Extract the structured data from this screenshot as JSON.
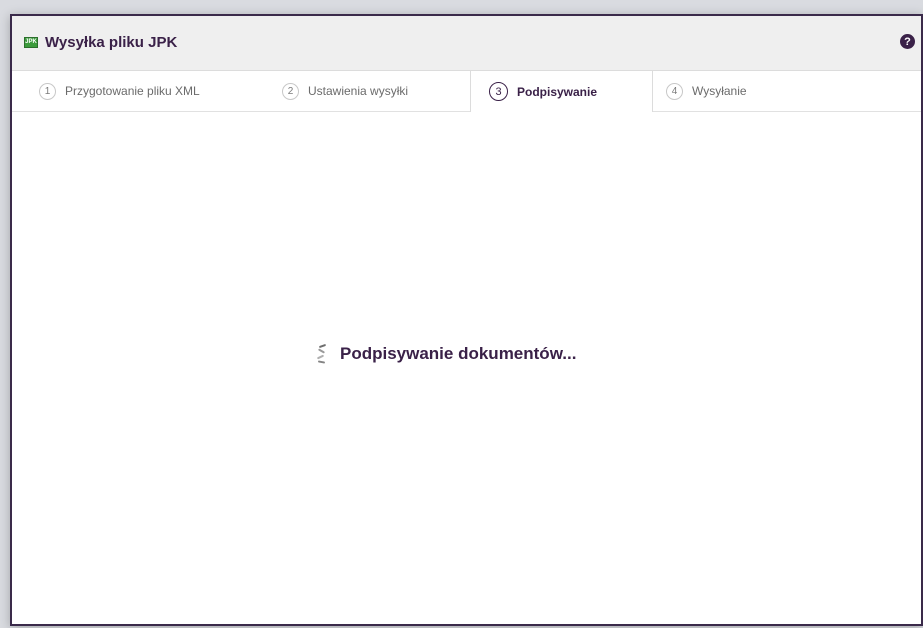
{
  "window": {
    "icon": "jpk-file-icon",
    "icon_text": "JPK",
    "title": "Wysyłka pliku JPK",
    "help_icon": "question-circle-icon",
    "help_glyph": "?"
  },
  "tabs": [
    {
      "number": "1",
      "label": "Przygotowanie pliku XML",
      "active": false
    },
    {
      "number": "2",
      "label": "Ustawienia wysyłki",
      "active": false
    },
    {
      "number": "3",
      "label": "Podpisywanie",
      "active": true
    },
    {
      "number": "4",
      "label": "Wysyłanie",
      "active": false
    }
  ],
  "status": {
    "icon": "spinner-icon",
    "message": "Podpisywanie dokumentów..."
  },
  "colors": {
    "accent": "#3a2148",
    "border": "#3a2a4a",
    "titlebar_bg": "#efefef",
    "icon_green": "#3c9b3c"
  }
}
